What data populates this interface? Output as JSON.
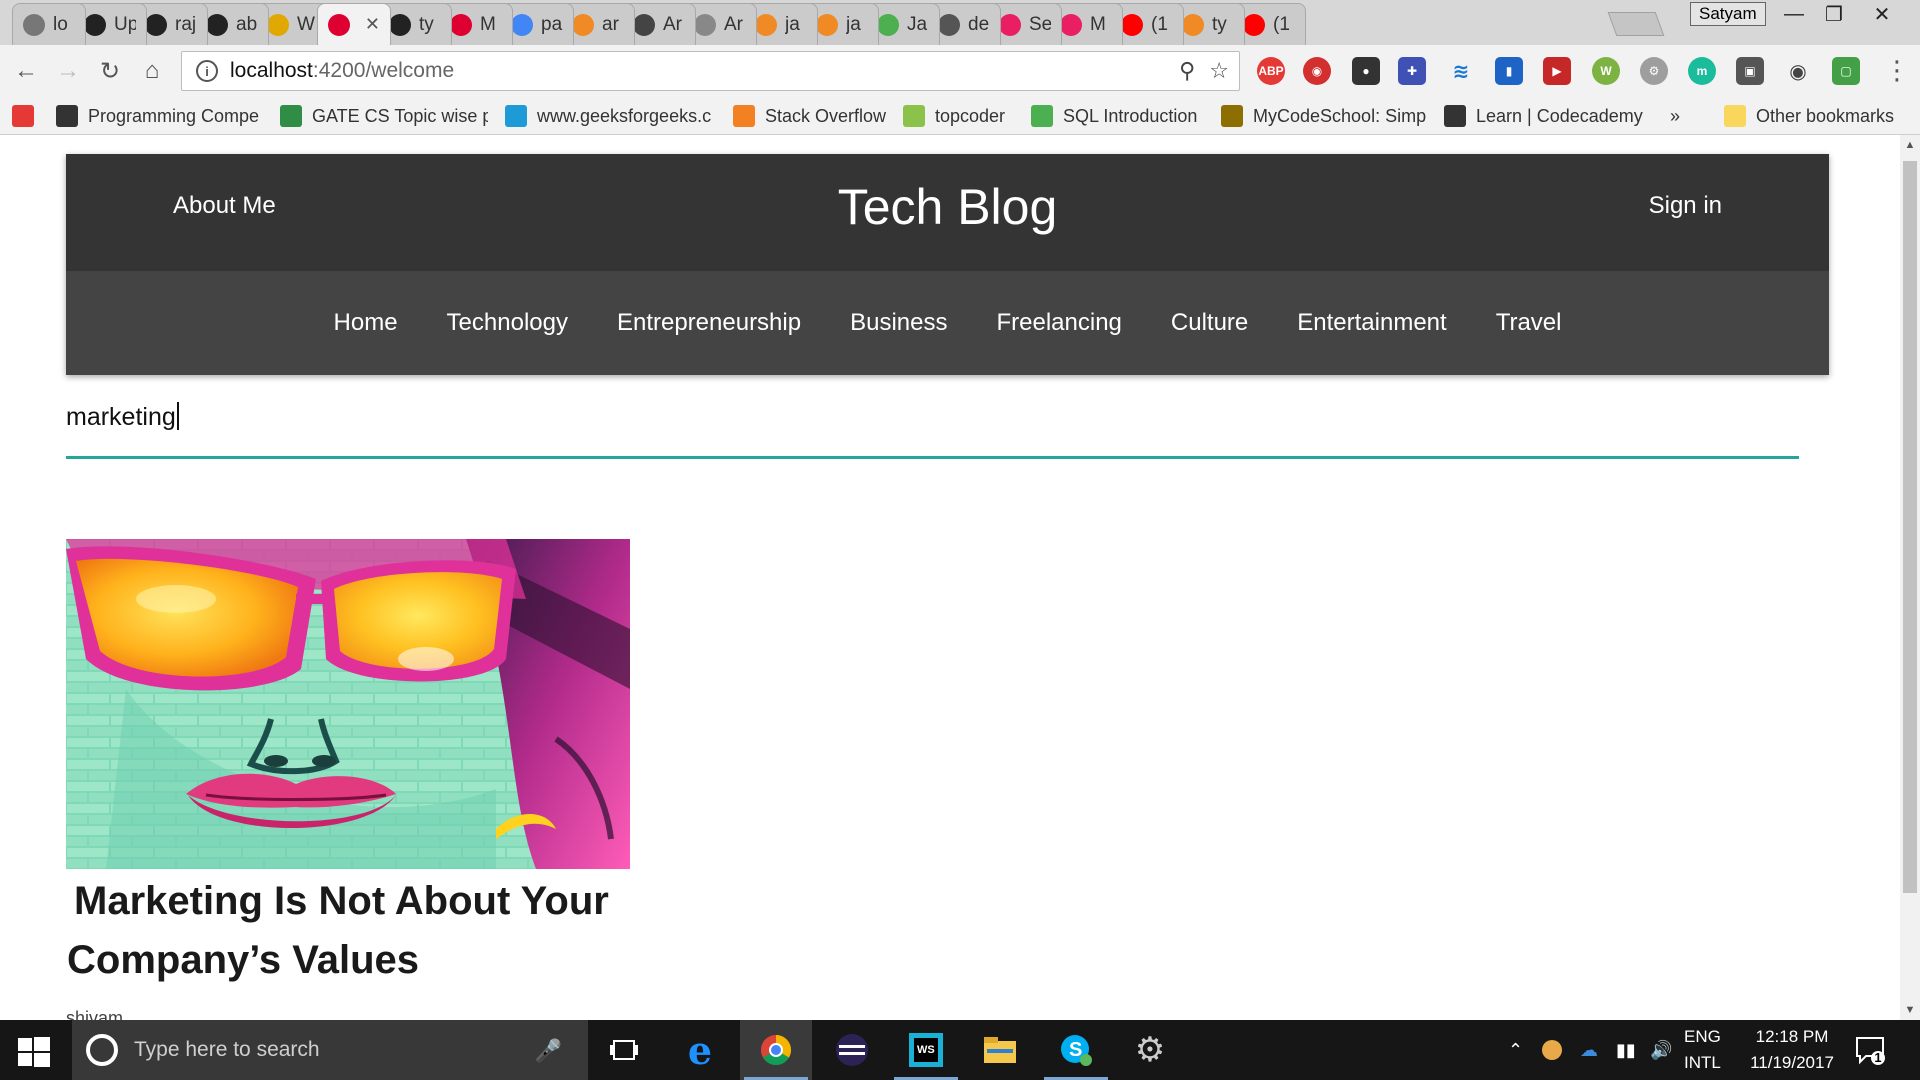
{
  "browser": {
    "tabs": [
      {
        "label": "lo",
        "icon": "smiley-icon",
        "color": "#777777"
      },
      {
        "label": "Up",
        "icon": "github-icon",
        "color": "#222222"
      },
      {
        "label": "raj",
        "icon": "github-icon",
        "color": "#222222"
      },
      {
        "label": "ab",
        "icon": "github-icon",
        "color": "#222222"
      },
      {
        "label": "W",
        "icon": "coin-icon",
        "color": "#e0a800"
      },
      {
        "label": "",
        "icon": "angular-icon",
        "color": "#dd0031",
        "active": true,
        "close": "✕"
      },
      {
        "label": "ty",
        "icon": "github-icon",
        "color": "#222222"
      },
      {
        "label": "M",
        "icon": "angular-icon",
        "color": "#dd0031"
      },
      {
        "label": "pa",
        "icon": "google-icon",
        "color": "#4285f4"
      },
      {
        "label": "ar",
        "icon": "feather-icon",
        "color": "#f08a24"
      },
      {
        "label": "Ar",
        "icon": "person-icon",
        "color": "#444444"
      },
      {
        "label": "Ar",
        "icon": "list-icon",
        "color": "#888888"
      },
      {
        "label": "ja",
        "icon": "feather-icon",
        "color": "#f08a24"
      },
      {
        "label": "ja",
        "icon": "feather-icon",
        "color": "#f08a24"
      },
      {
        "label": "Ja",
        "icon": "w3-icon",
        "color": "#4caf50"
      },
      {
        "label": "de",
        "icon": "ghost-icon",
        "color": "#555555"
      },
      {
        "label": "Se",
        "icon": "play-circle-icon",
        "color": "#e91e63"
      },
      {
        "label": "M",
        "icon": "play-circle-icon",
        "color": "#e91e63"
      },
      {
        "label": "(1",
        "icon": "youtube-icon",
        "color": "#ff0000"
      },
      {
        "label": "ty",
        "icon": "feather-icon",
        "color": "#f08a24"
      },
      {
        "label": "(1",
        "icon": "youtube-icon",
        "color": "#ff0000"
      }
    ],
    "profile_name": "Satyam",
    "url_host": "localhost",
    "url_path": ":4200/welcome",
    "bookmarks": [
      {
        "label": "",
        "icon": "triangle-icon",
        "color": "#e53935"
      },
      {
        "label": "Programming Compe",
        "icon": "cc-icon",
        "color": "#333333"
      },
      {
        "label": "GATE CS Topic wise p",
        "icon": "gfg-icon",
        "color": "#2f8d46"
      },
      {
        "label": "www.geeksforgeeks.c",
        "icon": "t-icon",
        "color": "#1e9bd7"
      },
      {
        "label": "Stack Overflow",
        "icon": "stackoverflow-icon",
        "color": "#f48024"
      },
      {
        "label": "topcoder",
        "icon": "topcoder-icon",
        "color": "#8bc34a"
      },
      {
        "label": "SQL Introduction",
        "icon": "w3-icon",
        "color": "#4caf50"
      },
      {
        "label": "MyCodeSchool: Simp",
        "icon": "code-icon",
        "color": "#8d6e00"
      },
      {
        "label": "Learn | Codecademy",
        "icon": "codecademy-icon",
        "color": "#333333"
      }
    ],
    "bookmarks_overflow": "»",
    "other_bookmarks": "Other bookmarks"
  },
  "site": {
    "about_label": "About Me",
    "brand": "Tech Blog",
    "signin_label": "Sign in",
    "nav": [
      "Home",
      "Technology",
      "Entrepreneurship",
      "Business",
      "Freelancing",
      "Culture",
      "Entertainment",
      "Travel"
    ],
    "search_value": "marketing",
    "accent_color": "#26a69a",
    "header_color": "#343434",
    "nav_color": "#444444"
  },
  "results": [
    {
      "title_line1": "Marketing Is Not About Your",
      "title_line2": "Company’s Values",
      "author": "shivam"
    }
  ],
  "taskbar": {
    "search_placeholder": "Type here to search",
    "language_top": "ENG",
    "language_bottom": "INTL",
    "time": "12:18 PM",
    "date": "11/19/2017",
    "notification_count": "1"
  }
}
